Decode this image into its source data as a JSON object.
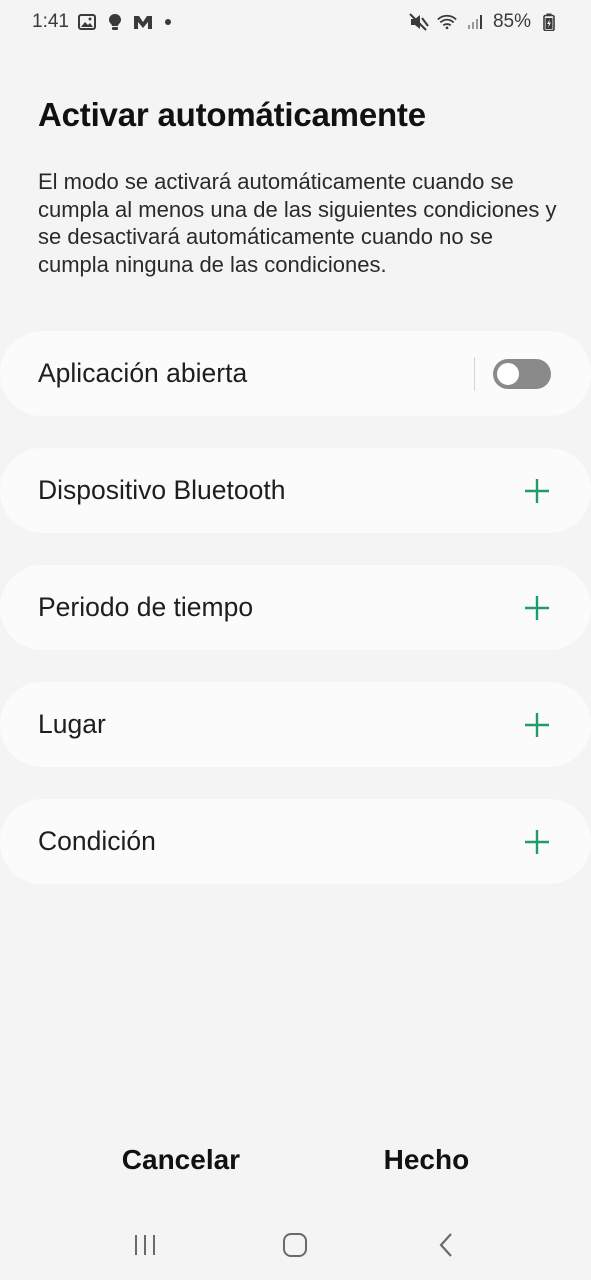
{
  "status_bar": {
    "time": "1:41",
    "battery": "85%",
    "left_icons": [
      "gallery-icon",
      "bulb-icon",
      "m-app-icon",
      "dot-icon"
    ],
    "right_icons": [
      "mute-icon",
      "wifi-icon",
      "signal-icon",
      "battery-icon"
    ]
  },
  "page": {
    "title": "Activar automáticamente",
    "description": "El modo se activará automáticamente cuando se cumpla al menos una de las siguientes condiciones y se desactivará automáticamente cuando no se cumpla ninguna de las condiciones."
  },
  "conditions": [
    {
      "label": "Aplicación abierta",
      "control": "toggle",
      "enabled": false
    },
    {
      "label": "Dispositivo Bluetooth",
      "control": "add"
    },
    {
      "label": "Periodo de tiempo",
      "control": "add"
    },
    {
      "label": "Lugar",
      "control": "add"
    },
    {
      "label": "Condición",
      "control": "add"
    }
  ],
  "buttons": {
    "cancel": "Cancelar",
    "done": "Hecho"
  },
  "nav_bar": {
    "icons": [
      "recent-apps-icon",
      "home-icon",
      "back-icon"
    ]
  },
  "colors": {
    "accent_plus": "#1f9c6b",
    "background": "#f4f4f4",
    "card": "#fbfbfb",
    "toggle_off": "#8a8a8a"
  }
}
